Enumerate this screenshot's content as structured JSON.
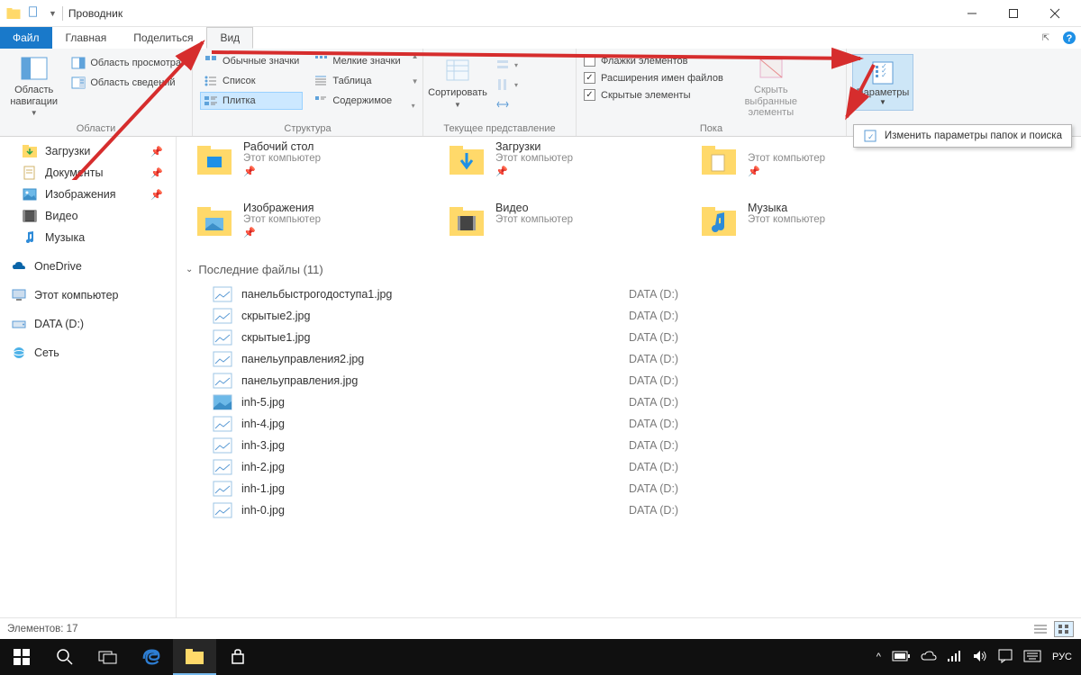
{
  "window": {
    "title": "Проводник"
  },
  "tabs": {
    "file": "Файл",
    "home": "Главная",
    "share": "Поделиться",
    "view": "Вид"
  },
  "ribbon": {
    "panes": {
      "label": "Области",
      "navPane": "Область\nнавигации",
      "previewPane": "Область просмотра",
      "detailsPane": "Область сведений"
    },
    "layout": {
      "label": "Структура",
      "big": "Обычные значки",
      "small": "Мелкие значки",
      "list": "Список",
      "table": "Таблица",
      "tiles": "Плитка",
      "content": "Содержимое"
    },
    "current": {
      "label": "Текущее представление",
      "sort": "Сортировать"
    },
    "showhide": {
      "label": "Показать или скрыть",
      "checkboxes": "Флажки элементов",
      "extensions": "Расширения имен файлов",
      "hidden": "Скрытые элементы",
      "hideSelected": "Скрыть выбранные элементы"
    },
    "options": {
      "label": "Параметры",
      "changeFolder": "Изменить параметры папок и поиска"
    }
  },
  "sidebar": {
    "downloads": "Загрузки",
    "documents": "Документы",
    "pictures": "Изображения",
    "videos": "Видео",
    "music": "Музыка",
    "onedrive": "OneDrive",
    "thispc": "Этот компьютер",
    "data": "DATA (D:)",
    "network": "Сеть"
  },
  "thumbs": {
    "subtitle": "Этот компьютер",
    "desktop": "Рабочий стол",
    "downloads": "Загрузки",
    "pictures": "Изображения",
    "videos": "Видео",
    "music": "Музыка"
  },
  "recent": {
    "header": "Последние файлы (11)",
    "location": "DATA (D:)",
    "files": [
      "панельбыстрогодоступа1.jpg",
      "скрытые2.jpg",
      "скрытые1.jpg",
      "панельуправления2.jpg",
      "панельуправления.jpg",
      "inh-5.jpg",
      "inh-4.jpg",
      "inh-3.jpg",
      "inh-2.jpg",
      "inh-1.jpg",
      "inh-0.jpg"
    ]
  },
  "statusbar": {
    "items": "Элементов: 17"
  },
  "taskbar": {
    "lang": "РУС"
  }
}
